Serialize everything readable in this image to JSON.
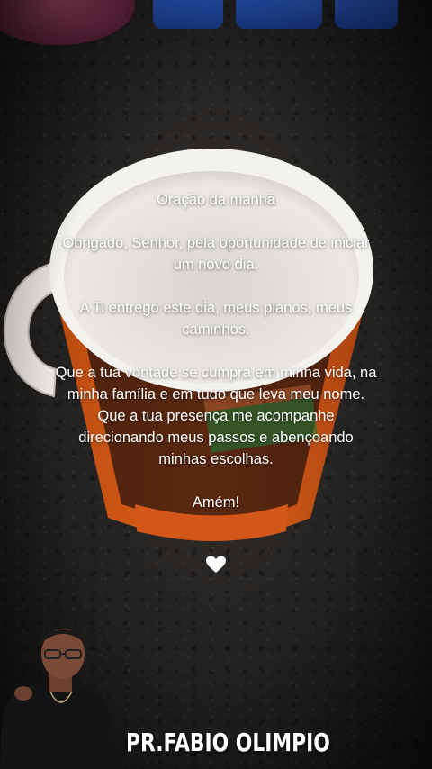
{
  "prayer": {
    "title": "Oração da manhã",
    "paragraph1": "Obrigado, Senhor, pela oportunidade de iniciar um novo dia.",
    "paragraph2": "A Ti entrego este dia, meus planos, meus caminhos.",
    "paragraph3": "Que a tua vontade se cumpra em minha vida, na minha família e em tudo que leva meu nome. Que a tua presença me acompanhe direcionando meus passos e abençoando minhas escolhas.",
    "closing": "Amém!"
  },
  "decoration": {
    "heart_icon": "white-heart-icon",
    "heart_color": "#ffffff"
  },
  "author": {
    "name": "PR.FABIO OLIMPIO"
  },
  "colors": {
    "mug_orange": "#e8661c",
    "mug_white": "#f2f0ee",
    "countertop": "#2a2725"
  }
}
